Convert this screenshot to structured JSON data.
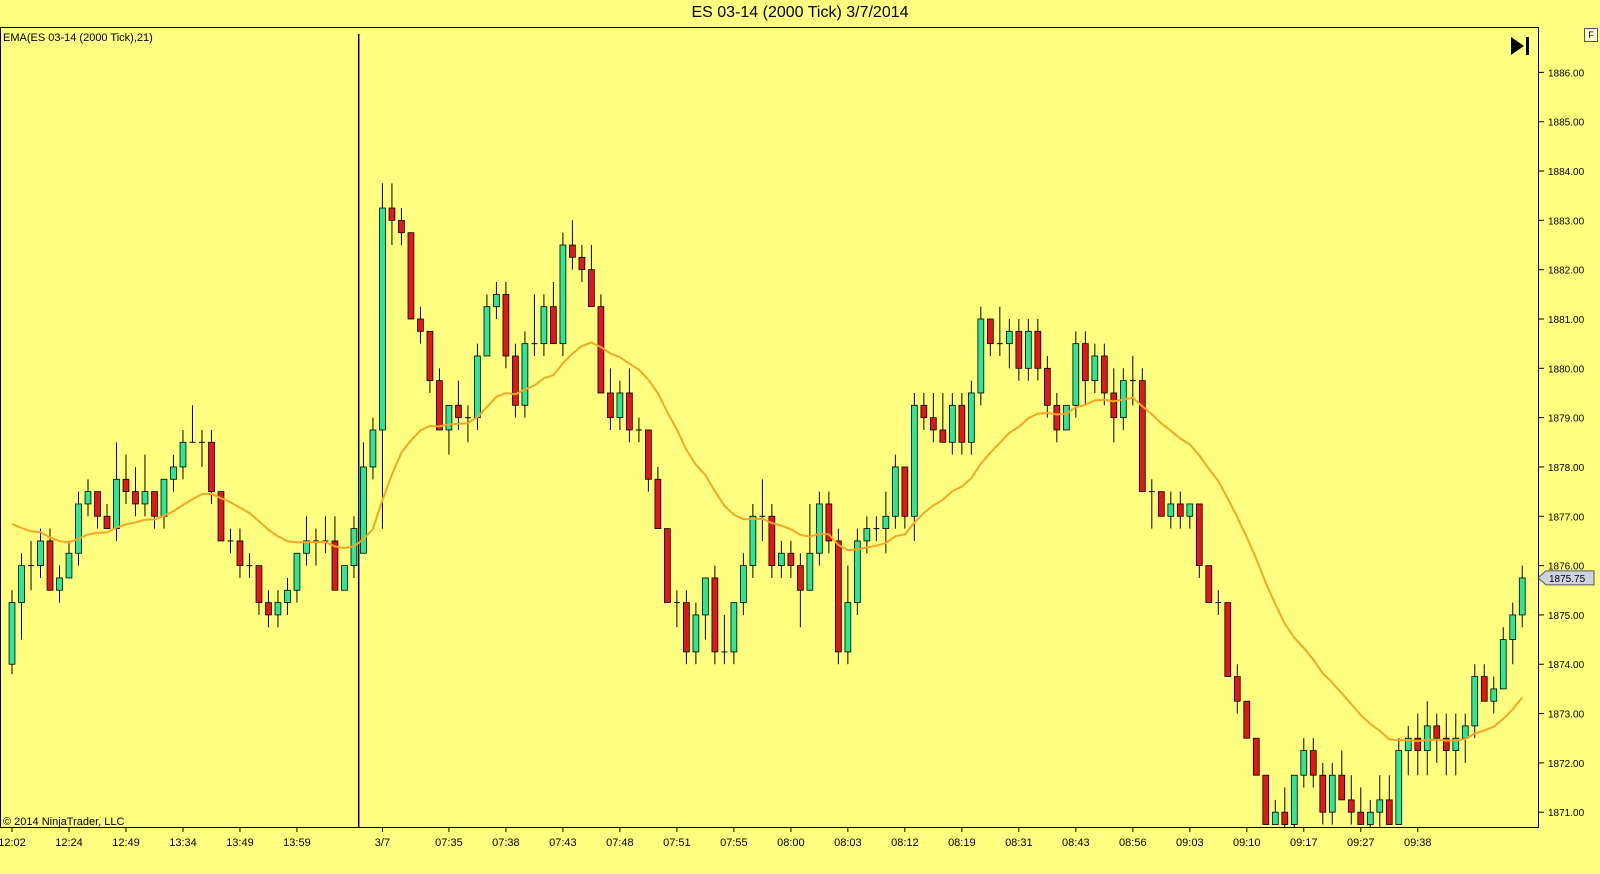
{
  "window": {
    "title": "ES 03-14 (2000 Tick)  3/7/2014",
    "indicator_label": "EMA(ES 03-14 (2000 Tick),21)",
    "copyright": "© 2014 NinjaTrader, LLC",
    "f_button": "F",
    "goto_end_icon": "skip-to-end-icon"
  },
  "colors": {
    "background": "#ffff80",
    "up": "#2ee69a",
    "down": "#e01818",
    "wick": "#000000",
    "ema": "#f5a623",
    "last_price_tag": "#cfd3e0"
  },
  "chart_data": {
    "type": "candlestick",
    "instrument": "ES 03-14",
    "interval": "2000 Tick",
    "y_ticks": [
      "1871.00",
      "1872.00",
      "1873.00",
      "1874.00",
      "1875.00",
      "1876.00",
      "1877.00",
      "1878.00",
      "1879.00",
      "1880.00",
      "1881.00",
      "1882.00",
      "1883.00",
      "1884.00",
      "1885.00",
      "1886.00"
    ],
    "ylim": [
      1870.7,
      1886.9
    ],
    "x_ticks": [
      {
        "label": "12:02",
        "bar": 0
      },
      {
        "label": "12:24",
        "bar": 6
      },
      {
        "label": "12:49",
        "bar": 12
      },
      {
        "label": "13:34",
        "bar": 18
      },
      {
        "label": "13:49",
        "bar": 24
      },
      {
        "label": "13:59",
        "bar": 30
      },
      {
        "label": "3/7",
        "bar": 39
      },
      {
        "label": "07:35",
        "bar": 46
      },
      {
        "label": "07:38",
        "bar": 52
      },
      {
        "label": "07:43",
        "bar": 58
      },
      {
        "label": "07:48",
        "bar": 64
      },
      {
        "label": "07:51",
        "bar": 70
      },
      {
        "label": "07:55",
        "bar": 76
      },
      {
        "label": "08:00",
        "bar": 82
      },
      {
        "label": "08:03",
        "bar": 88
      },
      {
        "label": "08:12",
        "bar": 94
      },
      {
        "label": "08:19",
        "bar": 100
      },
      {
        "label": "08:31",
        "bar": 106
      },
      {
        "label": "08:43",
        "bar": 112
      },
      {
        "label": "08:56",
        "bar": 118
      },
      {
        "label": "09:03",
        "bar": 124
      },
      {
        "label": "09:10",
        "bar": 130
      },
      {
        "label": "09:17",
        "bar": 136
      },
      {
        "label": "09:27",
        "bar": 142
      },
      {
        "label": "09:38",
        "bar": 148
      }
    ],
    "session_break_bar": 36.5,
    "last_price": "1875.75",
    "ohlc": [
      [
        1874,
        1875.5,
        1873.8,
        1875.25
      ],
      [
        1875.25,
        1876.25,
        1874.5,
        1876
      ],
      [
        1876,
        1876.5,
        1875.5,
        1876
      ],
      [
        1876,
        1876.75,
        1875.75,
        1876.5
      ],
      [
        1876.5,
        1876.75,
        1875.5,
        1875.5
      ],
      [
        1875.5,
        1876,
        1875.25,
        1875.75
      ],
      [
        1875.75,
        1876.5,
        1875.75,
        1876.25
      ],
      [
        1876.25,
        1877.5,
        1876,
        1877.25
      ],
      [
        1877.25,
        1877.75,
        1877,
        1877.5
      ],
      [
        1877.5,
        1877.5,
        1876.75,
        1877
      ],
      [
        1877,
        1877.25,
        1876.75,
        1876.75
      ],
      [
        1876.75,
        1878.5,
        1876.5,
        1877.75
      ],
      [
        1877.75,
        1878.25,
        1877.25,
        1877.5
      ],
      [
        1877.5,
        1878,
        1877,
        1877.25
      ],
      [
        1877.25,
        1878.25,
        1877,
        1877.5
      ],
      [
        1877.5,
        1877.5,
        1876.75,
        1877
      ],
      [
        1877,
        1877.75,
        1876.75,
        1877.75
      ],
      [
        1877.75,
        1878.25,
        1877.5,
        1878
      ],
      [
        1878,
        1878.75,
        1877.75,
        1878.5
      ],
      [
        1878.5,
        1879.25,
        1878.5,
        1878.5
      ],
      [
        1878.5,
        1878.75,
        1878,
        1878.5
      ],
      [
        1878.5,
        1878.75,
        1877.25,
        1877.5
      ],
      [
        1877.5,
        1877.5,
        1876.5,
        1876.5
      ],
      [
        1876.5,
        1876.75,
        1876.25,
        1876.5
      ],
      [
        1876.5,
        1876.75,
        1875.75,
        1876
      ],
      [
        1876,
        1876.25,
        1875.75,
        1876
      ],
      [
        1876,
        1876,
        1875,
        1875.25
      ],
      [
        1875.25,
        1875.5,
        1874.75,
        1875
      ],
      [
        1875,
        1875.5,
        1874.75,
        1875.25
      ],
      [
        1875.25,
        1875.75,
        1875,
        1875.5
      ],
      [
        1875.5,
        1876.25,
        1875.25,
        1876.25
      ],
      [
        1876.25,
        1877,
        1876,
        1876.5
      ],
      [
        1876.5,
        1876.75,
        1876,
        1876.5
      ],
      [
        1876.5,
        1877,
        1876.25,
        1876.5
      ],
      [
        1876.5,
        1877,
        1876,
        1875.5
      ],
      [
        1875.5,
        1876,
        1875.5,
        1876
      ],
      [
        1876,
        1877,
        1875.75,
        1876.75
      ],
      [
        1876.25,
        1878.5,
        1876.25,
        1878
      ],
      [
        1878,
        1879,
        1877.75,
        1878.75
      ],
      [
        1878.75,
        1883.75,
        1876.75,
        1883.25
      ],
      [
        1883.25,
        1883.75,
        1882.5,
        1883
      ],
      [
        1883,
        1883.25,
        1882.5,
        1882.75
      ],
      [
        1882.75,
        1882.75,
        1881,
        1881
      ],
      [
        1881,
        1881.25,
        1880.5,
        1880.75
      ],
      [
        1880.75,
        1880.75,
        1879.5,
        1879.75
      ],
      [
        1879.75,
        1880,
        1878.75,
        1878.75
      ],
      [
        1878.75,
        1879.25,
        1878.25,
        1879.25
      ],
      [
        1879.25,
        1879.75,
        1878.75,
        1879
      ],
      [
        1879,
        1879.25,
        1878.5,
        1879
      ],
      [
        1879,
        1880.5,
        1878.75,
        1880.25
      ],
      [
        1880.25,
        1881.5,
        1880.25,
        1881.25
      ],
      [
        1881.25,
        1881.75,
        1881,
        1881.5
      ],
      [
        1881.5,
        1881.75,
        1880,
        1880.25
      ],
      [
        1880.25,
        1880.5,
        1879,
        1879.25
      ],
      [
        1879.25,
        1880.75,
        1879,
        1880.5
      ],
      [
        1880.5,
        1881.5,
        1880.25,
        1880.5
      ],
      [
        1880.5,
        1881.5,
        1880.25,
        1881.25
      ],
      [
        1881.25,
        1881.75,
        1880.5,
        1880.5
      ],
      [
        1880.5,
        1882.75,
        1880.25,
        1882.5
      ],
      [
        1882.5,
        1883,
        1882,
        1882.25
      ],
      [
        1882.25,
        1882.5,
        1881.75,
        1882
      ],
      [
        1882,
        1882.5,
        1881.25,
        1881.25
      ],
      [
        1881.25,
        1881.5,
        1879.5,
        1879.5
      ],
      [
        1879.5,
        1880,
        1878.75,
        1879
      ],
      [
        1879,
        1879.75,
        1878.75,
        1879.5
      ],
      [
        1879.5,
        1880,
        1878.5,
        1878.75
      ],
      [
        1878.75,
        1879,
        1878.5,
        1878.75
      ],
      [
        1878.75,
        1878.75,
        1877.5,
        1877.75
      ],
      [
        1877.75,
        1878,
        1876.75,
        1876.75
      ],
      [
        1876.75,
        1876.75,
        1875.25,
        1875.25
      ],
      [
        1875.25,
        1875.5,
        1874.75,
        1875.25
      ],
      [
        1875.25,
        1875.5,
        1874,
        1874.25
      ],
      [
        1874.25,
        1875.25,
        1874,
        1875
      ],
      [
        1875,
        1875.75,
        1874.5,
        1875.75
      ],
      [
        1875.75,
        1876,
        1874,
        1874.25
      ],
      [
        1874.25,
        1875,
        1874,
        1874.25
      ],
      [
        1874.25,
        1875.25,
        1874,
        1875.25
      ],
      [
        1875.25,
        1876.25,
        1875,
        1876
      ],
      [
        1876,
        1877.25,
        1875.75,
        1877
      ],
      [
        1877,
        1877.75,
        1876.5,
        1877
      ],
      [
        1877,
        1877.25,
        1875.75,
        1876
      ],
      [
        1876,
        1876.5,
        1875.75,
        1876.25
      ],
      [
        1876.25,
        1876.5,
        1875.75,
        1876
      ],
      [
        1876,
        1876.25,
        1874.75,
        1875.5
      ],
      [
        1875.5,
        1877.25,
        1875.5,
        1876.25
      ],
      [
        1876.25,
        1877.5,
        1876,
        1877.25
      ],
      [
        1877.25,
        1877.5,
        1876.25,
        1876.5
      ],
      [
        1876.5,
        1876.75,
        1874,
        1874.25
      ],
      [
        1874.25,
        1876,
        1874,
        1875.25
      ],
      [
        1875.25,
        1876.75,
        1875,
        1876.5
      ],
      [
        1876.5,
        1877,
        1876.25,
        1876.75
      ],
      [
        1876.75,
        1877,
        1876.5,
        1876.75
      ],
      [
        1876.75,
        1877.5,
        1876.25,
        1877
      ],
      [
        1877,
        1878.25,
        1876.75,
        1878
      ],
      [
        1878,
        1878,
        1876.75,
        1877
      ],
      [
        1877,
        1879.5,
        1876.5,
        1879.25
      ],
      [
        1879.25,
        1879.5,
        1878.75,
        1879
      ],
      [
        1879,
        1879.5,
        1878.5,
        1878.75
      ],
      [
        1878.75,
        1879.5,
        1878.5,
        1878.5
      ],
      [
        1878.5,
        1879.5,
        1878.25,
        1879.25
      ],
      [
        1879.25,
        1879.5,
        1878.25,
        1878.5
      ],
      [
        1878.5,
        1879.75,
        1878.25,
        1879.5
      ],
      [
        1879.5,
        1881.25,
        1879.25,
        1881
      ],
      [
        1881,
        1881,
        1880.25,
        1880.5
      ],
      [
        1880.5,
        1881.25,
        1880.25,
        1880.5
      ],
      [
        1880.5,
        1881,
        1880,
        1880.75
      ],
      [
        1880.75,
        1881,
        1879.75,
        1880
      ],
      [
        1880,
        1881,
        1879.75,
        1880.75
      ],
      [
        1880.75,
        1881,
        1879.75,
        1880
      ],
      [
        1880,
        1880.25,
        1879,
        1879.25
      ],
      [
        1879.25,
        1879.5,
        1878.5,
        1878.75
      ],
      [
        1878.75,
        1879.25,
        1878.75,
        1879.25
      ],
      [
        1879.25,
        1880.75,
        1879,
        1880.5
      ],
      [
        1880.5,
        1880.75,
        1879.25,
        1879.75
      ],
      [
        1879.75,
        1880.5,
        1879.5,
        1880.25
      ],
      [
        1880.25,
        1880.5,
        1879.25,
        1879.5
      ],
      [
        1879.5,
        1880,
        1878.5,
        1879
      ],
      [
        1879,
        1880,
        1878.75,
        1879.75
      ],
      [
        1879.75,
        1880.25,
        1879.25,
        1879.75
      ],
      [
        1879.75,
        1880,
        1877.5,
        1877.5
      ],
      [
        1877.5,
        1877.75,
        1876.75,
        1877.5
      ],
      [
        1877.5,
        1877.5,
        1877,
        1877
      ],
      [
        1877,
        1877.5,
        1876.75,
        1877.25
      ],
      [
        1877.25,
        1877.5,
        1876.75,
        1877
      ],
      [
        1877,
        1877.25,
        1876.75,
        1877.25
      ],
      [
        1877.25,
        1877.25,
        1875.75,
        1876
      ],
      [
        1876,
        1876,
        1875.25,
        1875.25
      ],
      [
        1875.25,
        1875.5,
        1875,
        1875.25
      ],
      [
        1875.25,
        1875.25,
        1873.75,
        1873.75
      ],
      [
        1873.75,
        1874,
        1873,
        1873.25
      ],
      [
        1873.25,
        1873.25,
        1872.5,
        1872.5
      ],
      [
        1872.5,
        1872.5,
        1871.75,
        1871.75
      ],
      [
        1871.75,
        1871.75,
        1870.75,
        1870.75
      ],
      [
        1870.75,
        1871.25,
        1870.75,
        1871
      ],
      [
        1871,
        1871.5,
        1870.5,
        1870.75
      ],
      [
        1870.75,
        1871.75,
        1870.5,
        1871.75
      ],
      [
        1871.75,
        1872.5,
        1871.5,
        1872.25
      ],
      [
        1872.25,
        1872.5,
        1871.5,
        1871.75
      ],
      [
        1871.75,
        1872,
        1870.75,
        1871
      ],
      [
        1871,
        1872,
        1870.75,
        1871.75
      ],
      [
        1871.75,
        1872.25,
        1871.25,
        1871.25
      ],
      [
        1871.25,
        1871.75,
        1870.75,
        1871
      ],
      [
        1871,
        1871.5,
        1870.75,
        1870.75
      ],
      [
        1870.75,
        1871.25,
        1870.5,
        1871
      ],
      [
        1871,
        1871.75,
        1870.5,
        1871.25
      ],
      [
        1871.25,
        1871.75,
        1870.75,
        1870.75
      ],
      [
        1870.75,
        1872.5,
        1870.75,
        1872.25
      ],
      [
        1872.25,
        1872.75,
        1871.75,
        1872.5
      ],
      [
        1872.5,
        1873,
        1871.75,
        1872.25
      ],
      [
        1872.25,
        1873.25,
        1871.75,
        1872.75
      ],
      [
        1872.75,
        1873,
        1872,
        1872.5
      ],
      [
        1872.5,
        1873,
        1871.75,
        1872.25
      ],
      [
        1872.25,
        1873,
        1871.75,
        1872.5
      ],
      [
        1872.5,
        1873,
        1872,
        1872.75
      ],
      [
        1872.75,
        1874,
        1872.5,
        1873.75
      ],
      [
        1873.75,
        1874,
        1873.25,
        1873.25
      ],
      [
        1873.25,
        1873.75,
        1873,
        1873.5
      ],
      [
        1873.5,
        1874.75,
        1873.5,
        1874.5
      ],
      [
        1874.5,
        1875.25,
        1874,
        1875
      ],
      [
        1875,
        1876,
        1874.75,
        1875.75
      ]
    ],
    "ema_period": 21
  }
}
